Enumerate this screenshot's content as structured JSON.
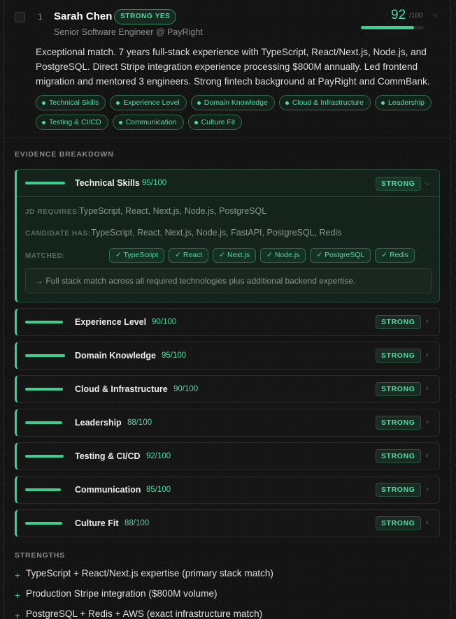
{
  "candidate": {
    "rank": "1",
    "name": "Sarah Chen",
    "verdict": "STRONG YES",
    "role": "Senior Software Engineer @ PayRight",
    "score": "92",
    "score_max": "/100",
    "score_fraction": 0.92,
    "summary": "Exceptional match. 7 years full-stack experience with TypeScript, React/Next.js, Node.js, and PostgreSQL. Direct Stripe integration experience processing $800M annually. Led frontend migration and mentored 3 engineers. Strong fintech background at PayRight and CommBank.",
    "tags": [
      "Technical Skills",
      "Experience Level",
      "Domain Knowledge",
      "Cloud & Infrastructure",
      "Leadership",
      "Testing & CI/CD",
      "Communication",
      "Culture Fit"
    ]
  },
  "evidence": {
    "title": "EVIDENCE BREAKDOWN",
    "expanded": {
      "name": "Technical Skills",
      "score": "95/100",
      "fraction": 0.95,
      "badge": "STRONG",
      "jd_label": "JD REQUIRES:",
      "jd_value": "TypeScript, React, Next.js, Node.js, PostgreSQL",
      "cand_label": "CANDIDATE HAS:",
      "cand_value": "TypeScript, React, Next.js, Node.js, FastAPI, PostgreSQL, Redis",
      "matched_label": "MATCHED:",
      "matched": [
        "✓ TypeScript",
        "✓ React",
        "✓ Next.js",
        "✓ Node.js",
        "✓ PostgreSQL",
        "✓ Redis"
      ],
      "rationale": "→ Full stack match across all required technologies plus additional backend expertise."
    },
    "rows": [
      {
        "name": "Experience Level",
        "score": "90/100",
        "fraction": 0.9,
        "badge": "STRONG"
      },
      {
        "name": "Domain Knowledge",
        "score": "95/100",
        "fraction": 0.95,
        "badge": "STRONG"
      },
      {
        "name": "Cloud & Infrastructure",
        "score": "90/100",
        "fraction": 0.9,
        "badge": "STRONG"
      },
      {
        "name": "Leadership",
        "score": "88/100",
        "fraction": 0.88,
        "badge": "STRONG"
      },
      {
        "name": "Testing & CI/CD",
        "score": "92/100",
        "fraction": 0.92,
        "badge": "STRONG"
      },
      {
        "name": "Communication",
        "score": "85/100",
        "fraction": 0.85,
        "badge": "STRONG"
      },
      {
        "name": "Culture Fit",
        "score": "88/100",
        "fraction": 0.88,
        "badge": "STRONG"
      }
    ]
  },
  "strengths": {
    "title": "STRENGTHS",
    "items": [
      "TypeScript + React/Next.js expertise (primary stack match)",
      "Production Stripe integration ($800M volume)",
      "PostgreSQL + Redis + AWS (exact infrastructure match)"
    ]
  },
  "colors": {
    "accent": "#3ecf8e",
    "accent_text": "#4fdca0",
    "rank": "#8a7ff0"
  }
}
